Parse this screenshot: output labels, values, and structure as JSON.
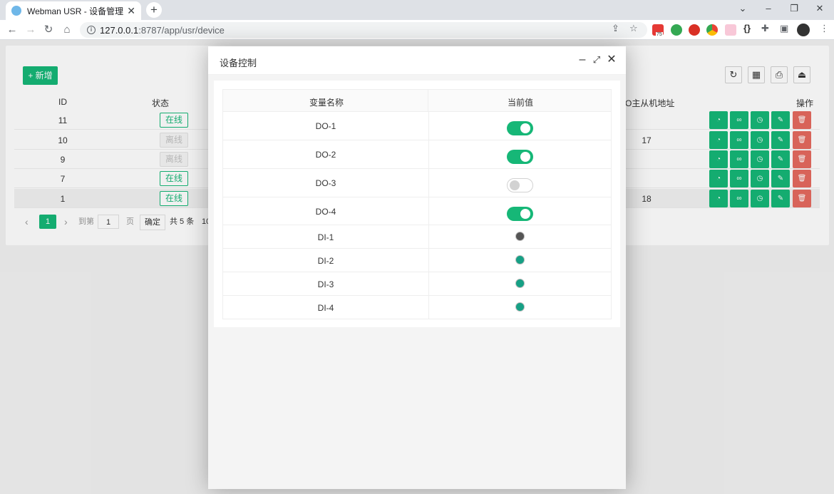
{
  "browser": {
    "tab_title": "Webman USR - 设备管理",
    "tab_close": "✕",
    "new_tab": "+",
    "url_host": "127.0.0.1",
    "url_path": ":8787/app/usr/device",
    "ext_badge": "75"
  },
  "page": {
    "add_label": "+ 新增",
    "headers": {
      "id": "ID",
      "status": "状态",
      "addr": "O主从机地址",
      "ops": "操作"
    },
    "rows": [
      {
        "id": "11",
        "status": "在线",
        "addr": ""
      },
      {
        "id": "10",
        "status": "离线",
        "addr": "17"
      },
      {
        "id": "9",
        "status": "离线",
        "addr": ""
      },
      {
        "id": "7",
        "status": "在线",
        "addr": ""
      },
      {
        "id": "1",
        "status": "在线",
        "addr": "18"
      }
    ],
    "pager": {
      "prev": "‹",
      "current": "1",
      "next": "›",
      "goto": "到第",
      "input": "1",
      "page_unit": "页",
      "confirm": "确定",
      "total": "共 5 条",
      "size": "10"
    }
  },
  "modal": {
    "title": "设备控制",
    "headers": {
      "name": "变量名称",
      "value": "当前值"
    },
    "outputs": [
      {
        "name": "DO-1",
        "on": true
      },
      {
        "name": "DO-2",
        "on": true
      },
      {
        "name": "DO-3",
        "on": false
      },
      {
        "name": "DO-4",
        "on": true
      }
    ],
    "inputs": [
      {
        "name": "DI-1",
        "color": "#555555"
      },
      {
        "name": "DI-2",
        "color": "#16a085"
      },
      {
        "name": "DI-3",
        "color": "#16a085"
      },
      {
        "name": "DI-4",
        "color": "#16a085"
      }
    ]
  },
  "colors": {
    "accent": "#16b777",
    "danger": "#e66a5f"
  }
}
